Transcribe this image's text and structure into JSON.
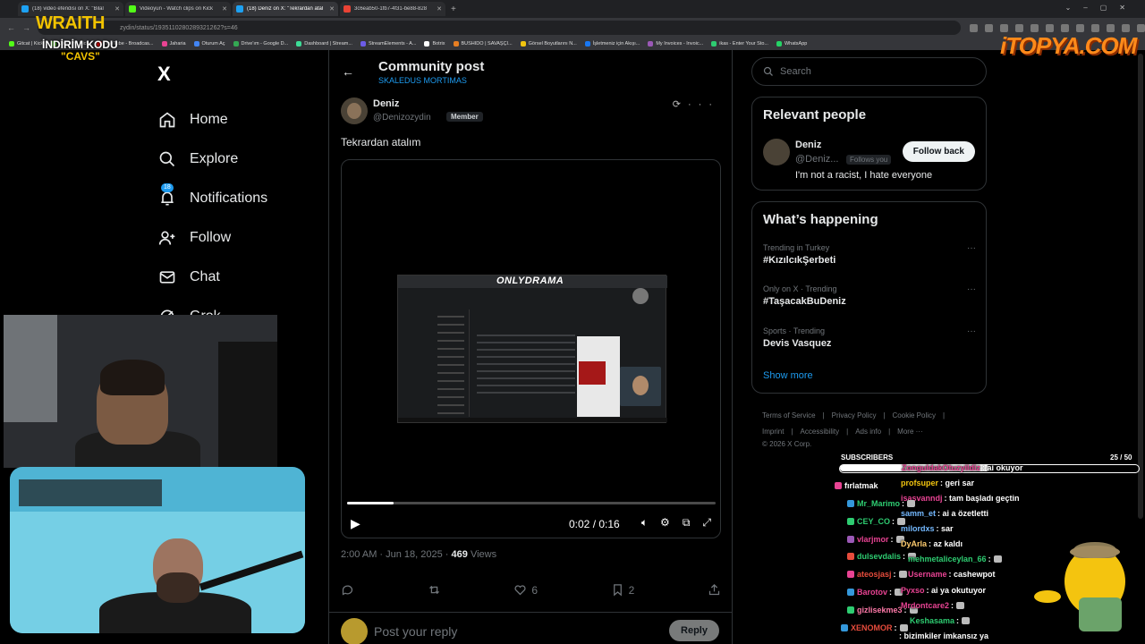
{
  "browser": {
    "tabs": [
      {
        "title": "(18) video efendisi on X: \"Bilal",
        "color": "#1da1f2",
        "active": false
      },
      {
        "title": "Videoyun - Watch clips on Kick",
        "color": "#53fc18",
        "active": false
      },
      {
        "title": "(18) Deniz on X: \"Tekrardan atal",
        "color": "#1da1f2",
        "active": true
      },
      {
        "title": "3c6eab50-1fb7-4f31-be88-828",
        "color": "#ea4335",
        "active": false
      }
    ],
    "url": "zydin/status/1935110280289321262?s=46",
    "bookmarks": [
      {
        "label": "Gitcat | Kick",
        "color": "#53fc18"
      },
      {
        "label": "Jahrein | Kick",
        "color": "#53fc18"
      },
      {
        "label": "YouTube - Broadcas...",
        "color": "#ff0000"
      },
      {
        "label": "Jaharia",
        "color": "#e84393"
      },
      {
        "label": "Oturum Aç",
        "color": "#4285f4"
      },
      {
        "label": "Drive'ım - Google D...",
        "color": "#34a853"
      },
      {
        "label": "Dashboard | Stream...",
        "color": "#3ddc97"
      },
      {
        "label": "StreamElements - A...",
        "color": "#6c5ce7"
      },
      {
        "label": "Botrix",
        "color": "#ffffff"
      },
      {
        "label": "BUSHIDO | SAVAŞÇI...",
        "color": "#e67e22"
      },
      {
        "label": "Görsel Boyutlarını N...",
        "color": "#f1c40f"
      },
      {
        "label": "İşletmeniz için Akışı...",
        "color": "#1877f2"
      },
      {
        "label": "My Invoices - Invoic...",
        "color": "#9b59b6"
      },
      {
        "label": "ikas - Enter Your Sto...",
        "color": "#2ecc71"
      },
      {
        "label": "WhatsApp",
        "color": "#25d366"
      }
    ]
  },
  "overlay": {
    "wraith": "WRAITH",
    "code_line": "İNDİRİM KODU",
    "code": "\"CAVS\"",
    "sponsor": "iTOPYA.COM"
  },
  "nav": {
    "logo": "X",
    "items": [
      {
        "label": "Home",
        "icon": "home-icon"
      },
      {
        "label": "Explore",
        "icon": "search-icon"
      },
      {
        "label": "Notifications",
        "icon": "bell-icon",
        "badge": "18"
      },
      {
        "label": "Follow",
        "icon": "follow-icon"
      },
      {
        "label": "Chat",
        "icon": "mail-icon"
      },
      {
        "label": "Grok",
        "icon": "grok-icon"
      }
    ]
  },
  "post": {
    "header_title": "Community post",
    "community": "SKALEDUS MORTIMAS",
    "author_name": "Deniz",
    "author_handle": "@Denizozydin",
    "member_badge": "Member",
    "text": "Tekrardan atalım",
    "video": {
      "thumb_label": "ONLYDRAMA",
      "time": "0:02 / 0:16",
      "progress": 0.125
    },
    "timestamp": "2:00 AM · Jun 18, 2025 · ",
    "views_count": "469",
    "views_label": " Views",
    "likes": "6",
    "bookmarks": "2",
    "reply_placeholder": "Post your reply",
    "reply_button": "Reply"
  },
  "sidebar": {
    "search_placeholder": "Search",
    "relevant": {
      "title": "Relevant people",
      "name": "Deniz",
      "handle": "@Deniz...",
      "follows_you": "Follows you",
      "button": "Follow back",
      "bio": "I'm not a racist, I hate everyone"
    },
    "happening": {
      "title": "What’s happening",
      "trends": [
        {
          "meta": "Trending in Turkey",
          "name": "#KızılcıkŞerbeti"
        },
        {
          "meta": "Only on X · Trending",
          "name": "#TaşacakBuDeniz"
        },
        {
          "meta": "Sports · Trending",
          "name": "Devis Vasquez"
        }
      ],
      "show_more": "Show more"
    },
    "footer": {
      "links1": [
        "Terms of Service",
        "|",
        "Privacy Policy",
        "|",
        "Cookie Policy",
        "|"
      ],
      "links2": [
        "Imprint",
        "|",
        "Accessibility",
        "|",
        "Ads info",
        "|",
        "More ···"
      ],
      "copyright": "© 2026 X Corp."
    }
  },
  "stream": {
    "subs_label": "SUBSCRIBERS",
    "subs_count": "25 / 50",
    "subs_progress": 0.5,
    "chat": [
      {
        "user": "ZonguldakOtuzyildiz",
        "msg": ": ai okuyor",
        "color": "#e84393"
      },
      {
        "user": "profsuper",
        "msg": ": geri sar",
        "color": "#f1c40f"
      },
      {
        "user": "fırlatmak",
        "msg": "",
        "color": "#ffffff"
      },
      {
        "user": "isasvanndj",
        "msg": ": tam başladı geçtin",
        "color": "#e84393"
      },
      {
        "user": "Mr_Marimo",
        "msg": ":",
        "color": "#2ecc71"
      },
      {
        "user": "samm_et",
        "msg": ": ai a özetletti",
        "color": "#74b9ff"
      },
      {
        "user": "CEY_CO",
        "msg": ":",
        "color": "#2ecc71"
      },
      {
        "user": "milordxs",
        "msg": ": sar",
        "color": "#74b9ff"
      },
      {
        "user": "vlarjmor",
        "msg": ":",
        "color": "#e84393"
      },
      {
        "user": "DyArla",
        "msg": ": az kaldı",
        "color": "#fdcb6e"
      },
      {
        "user": "dulsevdalis",
        "msg": ":",
        "color": "#2ecc71"
      },
      {
        "user": "mehmetaliceylan_66",
        "msg": ":",
        "color": "#2ecc71"
      },
      {
        "user": "ateosjasj",
        "msg": ":",
        "color": "#e74c3c"
      },
      {
        "user": "Username",
        "msg": ": cashewpot",
        "color": "#e84393"
      },
      {
        "user": "Barotov",
        "msg": ":",
        "color": "#e84393"
      },
      {
        "user": "Pyxso",
        "msg": ": ai ya okutuyor",
        "color": "#e84393"
      },
      {
        "user": "gizlisekme3",
        "msg": ":",
        "color": "#fd79a8"
      },
      {
        "user": "Mrdontcare2",
        "msg": ":",
        "color": "#e84393"
      },
      {
        "user": "Keshasama",
        "msg": ":",
        "color": "#2ecc71"
      },
      {
        "user": "XENOMOR",
        "msg": ":",
        "color": "#e74c3c"
      },
      {
        "user": "",
        "msg": ": bizimkiler imkansız ya",
        "color": "#ffffff"
      }
    ]
  }
}
